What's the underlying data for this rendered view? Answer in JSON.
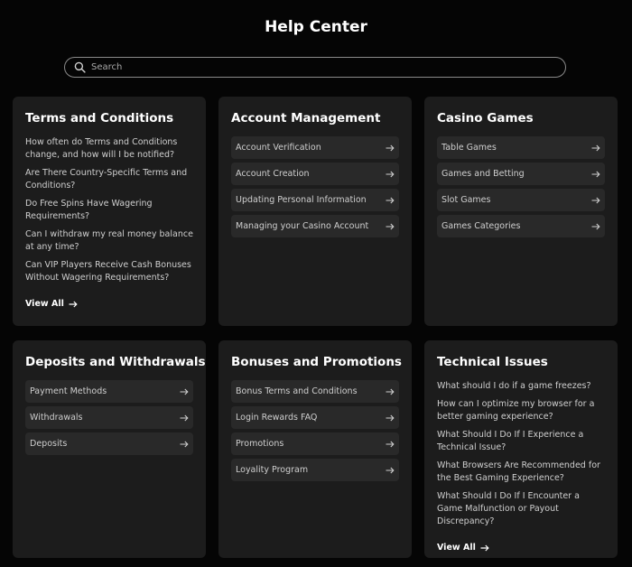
{
  "page": {
    "title": "Help Center"
  },
  "search": {
    "placeholder": "Search"
  },
  "cards": {
    "terms": {
      "title": "Terms and Conditions",
      "items": [
        "How often do Terms and Conditions change, and how will I be notified?",
        "Are There Country-Specific Terms and Conditions?",
        "Do Free Spins Have Wagering Requirements?",
        "Can I withdraw my real money balance at any time?",
        "Can VIP Players Receive Cash Bonuses Without Wagering Requirements?"
      ],
      "view_all": "View All"
    },
    "account": {
      "title": "Account Management",
      "links": [
        "Account Verification",
        "Account Creation",
        "Updating Personal Information",
        "Managing your Casino Account"
      ]
    },
    "casino": {
      "title": "Casino Games",
      "links": [
        "Table Games",
        "Games and Betting",
        "Slot Games",
        "Games Categories"
      ]
    },
    "deposits": {
      "title": "Deposits and Withdrawals",
      "links": [
        "Payment Methods",
        "Withdrawals",
        "Deposits"
      ]
    },
    "bonuses": {
      "title": "Bonuses and Promotions",
      "links": [
        "Bonus Terms and Conditions",
        "Login Rewards FAQ",
        "Promotions",
        "Loyality Program"
      ]
    },
    "technical": {
      "title": "Technical Issues",
      "items": [
        "What should I do if a game freezes?",
        "How can I optimize my browser for a better gaming experience?",
        "What Should I Do If I Experience a Technical Issue?",
        "What Browsers Are Recommended for the Best Gaming Experience?",
        "What Should I Do If I Encounter a Game Malfunction or Payout Discrepancy?"
      ],
      "view_all": "View All"
    }
  },
  "icons": {
    "search": "search-icon",
    "arrow": "arrow-right-icon"
  },
  "colors": {
    "background": "#050505",
    "card": "#1c1c1c",
    "link_row": "#292929",
    "text": "#cfcfcf",
    "heading": "#ffffff"
  }
}
